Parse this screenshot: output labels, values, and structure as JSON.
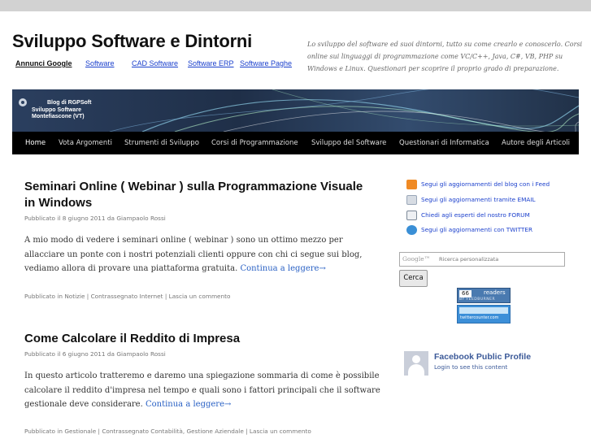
{
  "header": {
    "site_title": "Sviluppo Software e Dintorni",
    "description": "Lo sviluppo del software ed suoi dintorni, tutto su come crearlo e conoscerlo. Corsi online sui linguaggi di programmazione come VC/C++, Java, C#, VB, PHP su Windows e Linux. Questionari per scoprire il proprio grado di preparazione."
  },
  "ad_links": {
    "label": "Annunci Google",
    "items": [
      "Software",
      "CAD Software",
      "Software ERP",
      "Software Paghe"
    ]
  },
  "banner": {
    "line1": "Blog di RGPSoft",
    "line2": "Sviluppo Software",
    "line3": "Montefiascone (VT)"
  },
  "nav": {
    "items": [
      "Home",
      "Vota Argomenti",
      "Strumenti di Sviluppo",
      "Corsi di Programmazione",
      "Sviluppo del Software",
      "Questionari di Informatica",
      "Autore degli Articoli"
    ]
  },
  "posts": [
    {
      "title_line1": "Seminari Online ( Webinar ) sulla Programmazione Visuale",
      "title_line2": "in Windows",
      "meta": "Pubblicato il 8 giugno 2011 da Giampaolo Rossi",
      "body_line1": "A mio modo di vedere i seminari online ( webinar ) sono un ottimo mezzo per",
      "body_line2": "allacciare un ponte con i nostri potenziali clienti oppure con chi ci segue sui blog,",
      "body_line3": "vediamo allora di provare una piattaforma gratuita.",
      "more": "Continua a leggere→",
      "footer": "Pubblicato in Notizie | Contrassegnato Internet | Lascia un commento"
    },
    {
      "title_line1": "Come Calcolare il Reddito di Impresa",
      "meta": "Pubblicato il 6 giugno 2011 da Giampaolo Rossi",
      "body_line1": "In questo articolo tratteremo e daremo una spiegazione sommaria di come è possibile",
      "body_line2": "calcolare il reddito d'impresa nel tempo e quali sono i fattori principali che il software",
      "body_line3": "gestionale deve considerare.",
      "more": "Continua a leggere→",
      "footer": "Pubblicato in Gestionale | Contrassegnato Contabilità, Gestione Aziendale | Lascia un commento"
    }
  ],
  "sidebar": {
    "subscribe": [
      {
        "label": "Segui gli aggiornamenti del blog con i Feed",
        "icon": "rss-icon",
        "color": "#f08a24"
      },
      {
        "label": "Segui gli aggiornamenti tramite EMAIL",
        "icon": "email-icon",
        "color": "#9aa7b8"
      },
      {
        "label": "Chiedi agli esperti del nostro FORUM",
        "icon": "forum-icon",
        "color": "#7d8a99"
      },
      {
        "label": "Segui gli aggiornamenti con TWITTER",
        "icon": "twitter-icon",
        "color": "#3a8fd6"
      }
    ],
    "search": {
      "logo": "Google™",
      "placeholder": "Ricerca personalizzata",
      "button": "Cerca"
    },
    "feedburner": {
      "count": "66",
      "label": "readers",
      "by": "BY FEEDBURNER"
    },
    "twittercounter": {
      "label": "twittercounter.com"
    },
    "facebook": {
      "title": "Facebook Public Profile",
      "subtitle": "Login to see this content"
    }
  },
  "colors": {
    "nav_bg": "#000000",
    "link": "#1a3fcc",
    "more_link": "#2a61c4",
    "facebook": "#3b5998"
  }
}
